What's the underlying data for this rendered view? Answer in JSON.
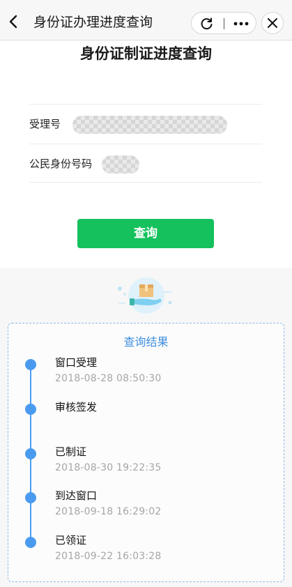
{
  "topbar": {
    "title": "身份证办理进度查询",
    "back_icon": "chevron-left-icon",
    "refresh_icon": "refresh-icon",
    "more_icon": "more-dots-icon",
    "close_icon": "close-icon"
  },
  "main": {
    "heading": "身份证制证进度查询",
    "fields": [
      {
        "label": "受理号"
      },
      {
        "label": "公民身份号码"
      }
    ],
    "query_button": "查询",
    "colors": {
      "primary": "#14c15c"
    }
  },
  "result": {
    "title": "查询结果",
    "accent": "#4a9bf0",
    "steps": [
      {
        "label": "窗口受理",
        "time": "2018-08-28 08:50:30"
      },
      {
        "label": "审核签发",
        "time": ""
      },
      {
        "label": "已制证",
        "time": "2018-08-30 19:22:35"
      },
      {
        "label": "到达窗口",
        "time": "2018-09-18 16:29:02"
      },
      {
        "label": "已领证",
        "time": "2018-09-22 16:03:28"
      }
    ]
  }
}
